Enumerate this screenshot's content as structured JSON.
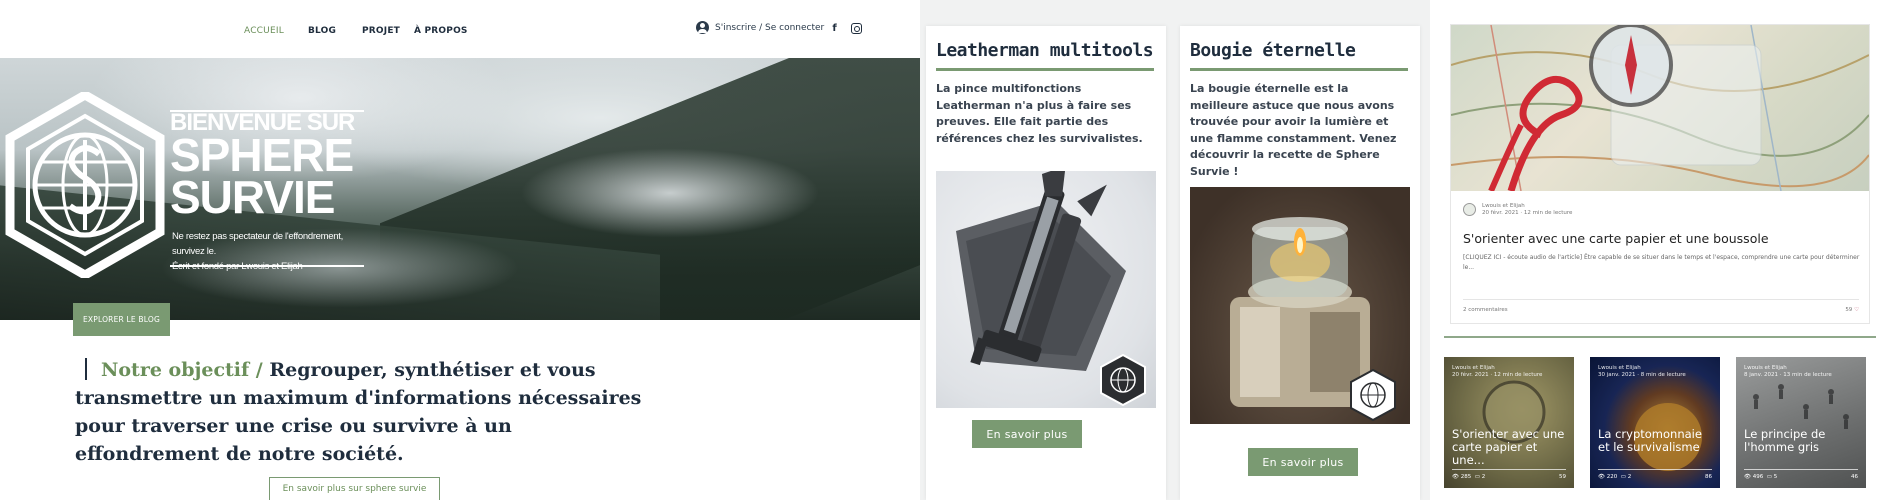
{
  "nav": {
    "items": [
      "ACCUEIL",
      "BLOG",
      "PROJET",
      "À PROPOS"
    ],
    "login_label": "S'inscrire / Se connecter",
    "facebook_glyph": "f"
  },
  "hero": {
    "title_line1": "BIENVENUE SUR",
    "title_line2": "SPHERE",
    "title_line3": "SURVIE",
    "subtitle_line1": "Ne restez pas spectateur de l'effondrement, survivez le.",
    "subtitle_line2": "Écrit et fondé par Lwouis et Elijah",
    "explore_button": "EXPLORER LE BLOG"
  },
  "objective": {
    "accent": "Notre objectif /",
    "text": "Regrouper, synthétiser et vous transmettre un maximum d'informations nécessaires pour traverser une crise ou survivre à un effondrement de notre société.",
    "more_button": "En savoir plus sur sphere survie"
  },
  "products": [
    {
      "title": "Leatherman multitools",
      "description": "La pince multifonctions Leatherman n'a plus à faire ses preuves. Elle fait partie des références chez les survivalistes.",
      "button": "En savoir plus"
    },
    {
      "title": "Bougie éternelle",
      "description": "La bougie éternelle est la meilleure astuce que nous avons trouvée pour avoir la lumière et une flamme constamment. Venez découvrir la recette de Sphere Survie !",
      "button": "En savoir plus"
    }
  ],
  "blog": {
    "featured": {
      "author": "Lwouis et Elijah",
      "date_read": "20 févr. 2021 · 12 min de lecture",
      "title": "S'orienter avec une carte papier et une boussole",
      "excerpt": "[CLIQUEZ ICI - écoute audio de l'article] Être capable de se situer dans le temps et l'espace, comprendre une carte pour déterminer le...",
      "comments": "2 commentaires",
      "likes": "59"
    },
    "thumbs": [
      {
        "author": "Lwouis et Elijah",
        "date": "20 févr. 2021 · 12 min de lecture",
        "title": "S'orienter avec une carte papier et une...",
        "views": "285",
        "comments": "2",
        "likes": "59",
        "bg": "#a8a37a"
      },
      {
        "author": "Lwouis et Elijah",
        "date": "30 janv. 2021 · 8 min de lecture",
        "title": "La cryptomonnaie et le survivalisme",
        "views": "220",
        "comments": "2",
        "likes": "86",
        "bg": "#1e3f7a"
      },
      {
        "author": "Lwouis et Elijah",
        "date": "8 janv. 2021 · 13 min de lecture",
        "title": "Le principe de l'homme gris",
        "views": "496",
        "comments": "5",
        "likes": "46",
        "bg": "#6f7272"
      }
    ]
  },
  "colors": {
    "accent_green": "#7a9a72",
    "heading_dark": "#1f2d3d",
    "like_red": "#c0506b"
  }
}
